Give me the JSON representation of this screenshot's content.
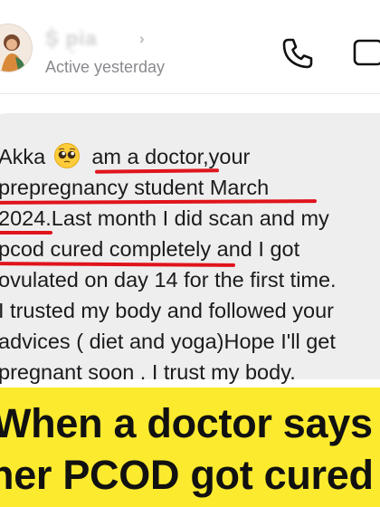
{
  "header": {
    "contact_name": "Ṩ p̣ia",
    "chevron": "›",
    "status": "Active yesterday",
    "icons": [
      "avatar",
      "chevron-right-icon",
      "phone-icon",
      "video-camera-icon"
    ]
  },
  "message": {
    "lines": [
      {
        "before": "Akka",
        "emoji": "pleading-face",
        "after": "  am a doctor,your"
      },
      {
        "text": "prepregnancy student March"
      },
      {
        "text": "2024.Last month I did scan and   my"
      },
      {
        "text": "pcod cured completely and I got"
      },
      {
        "text": "ovulated on day 14 for the first time."
      },
      {
        "text": "I trusted my body and followed your"
      },
      {
        "text": "advices ( diet and yoga)Hope I'll get"
      },
      {
        "text": "pregnant soon . I trust my body."
      }
    ],
    "annotation_color": "#e0141b"
  },
  "caption": {
    "line1": "When a doctor says",
    "line2": "her PCOD got cured"
  },
  "colors": {
    "bubble": "#eeeeef",
    "banner": "#fbea2e",
    "underline": "#e0141b",
    "status_text": "#8a8a8e"
  }
}
